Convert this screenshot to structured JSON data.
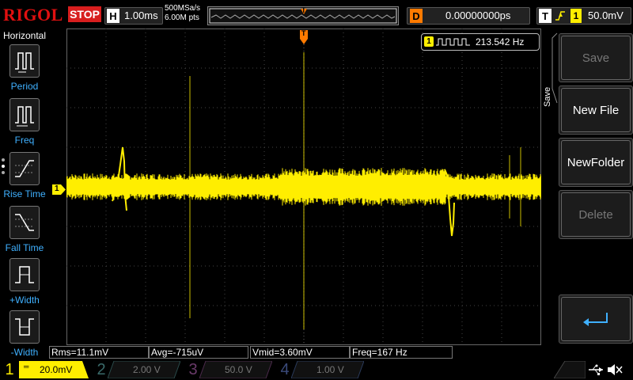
{
  "header": {
    "logo": "RIGOL",
    "run_state": "STOP",
    "horizontal_letter": "H",
    "timebase": "1.00ms",
    "sample_rate": "500MSa/s",
    "memory_depth": "6.00M pts",
    "delay_letter": "D",
    "delay_value": "0.00000000ps",
    "trigger_letter": "T",
    "trigger_level": "50.0mV",
    "trigger_icon": "rising-edge-icon"
  },
  "left_menu": {
    "title": "Horizontal",
    "items": [
      {
        "label": "Period",
        "icon": "period-icon"
      },
      {
        "label": "Freq",
        "icon": "freq-icon"
      },
      {
        "label": "Rise Time",
        "icon": "rise-time-icon"
      },
      {
        "label": "Fall Time",
        "icon": "fall-time-icon"
      },
      {
        "label": "+Width",
        "icon": "positive-width-icon"
      },
      {
        "label": "-Width",
        "icon": "negative-width-icon"
      }
    ]
  },
  "frequency_counter": {
    "channel": "1",
    "value": "213.542 Hz"
  },
  "channel1_marker": "1",
  "trigger_marker": "T",
  "measurements": [
    {
      "label": "Rms=11.1mV"
    },
    {
      "label": "Avg=-715uV"
    },
    {
      "label": "Vmid=3.60mV"
    },
    {
      "label": "Freq=167 Hz"
    }
  ],
  "right_menu": {
    "title": "Save",
    "buttons": [
      {
        "label": "Save",
        "enabled": false
      },
      {
        "label": "New File",
        "enabled": true
      },
      {
        "label": "NewFolder",
        "enabled": true
      },
      {
        "label": "Delete",
        "enabled": false
      }
    ],
    "enter_icon": "enter-icon"
  },
  "channels": [
    {
      "num": "1",
      "scale": "20.0mV",
      "color": "#ffee00",
      "active": true
    },
    {
      "num": "2",
      "scale": "2.00 V",
      "color": "#00e0e0",
      "active": false
    },
    {
      "num": "3",
      "scale": "50.0 V",
      "color": "#ff40ff",
      "active": false
    },
    {
      "num": "4",
      "scale": "1.00 V",
      "color": "#2f7bff",
      "active": false
    }
  ],
  "status_icons": [
    "usb-icon",
    "speaker-muted-icon"
  ],
  "colors": {
    "trace": "#ffee00",
    "trigger": "#ff7a00",
    "stop": "#d81e1e",
    "menu_label": "#3fb0ff"
  }
}
